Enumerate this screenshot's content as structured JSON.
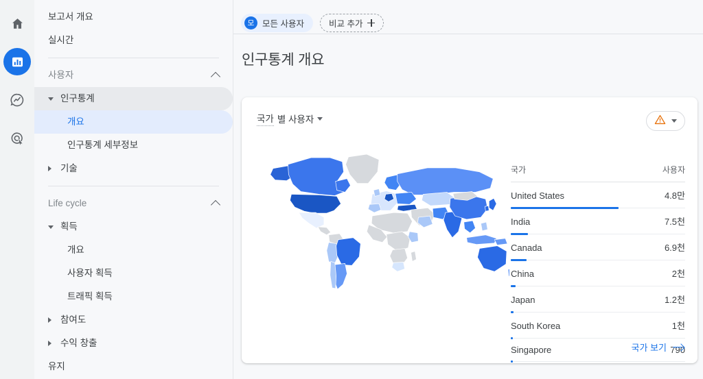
{
  "rail": {
    "items": [
      {
        "name": "home-icon",
        "label": "홈",
        "active": false
      },
      {
        "name": "reports-icon",
        "label": "보고서",
        "active": true
      },
      {
        "name": "explore-icon",
        "label": "탐색",
        "active": false
      },
      {
        "name": "advertising-icon",
        "label": "광고",
        "active": false
      }
    ]
  },
  "sidebar": {
    "items": [
      {
        "label": "보고서 개요",
        "level": 0,
        "state": "normal",
        "tri": "none"
      },
      {
        "label": "실시간",
        "level": 0,
        "state": "normal",
        "tri": "none"
      },
      {
        "divider": true
      },
      {
        "label": "사용자",
        "level": 0,
        "state": "section",
        "tri": "collapse-up"
      },
      {
        "label": "인구통계",
        "level": 1,
        "state": "hovered",
        "tri": "down"
      },
      {
        "label": "개요",
        "level": 2,
        "state": "selected",
        "tri": "none"
      },
      {
        "label": "인구통계 세부정보",
        "level": 2,
        "state": "normal",
        "tri": "none"
      },
      {
        "label": "기술",
        "level": 1,
        "state": "normal",
        "tri": "right"
      },
      {
        "divider": true
      },
      {
        "label": "Life cycle",
        "level": 0,
        "state": "section",
        "tri": "collapse-up"
      },
      {
        "label": "획득",
        "level": 1,
        "state": "normal",
        "tri": "down"
      },
      {
        "label": "개요",
        "level": 2,
        "state": "normal",
        "tri": "none"
      },
      {
        "label": "사용자 획득",
        "level": 2,
        "state": "normal",
        "tri": "none"
      },
      {
        "label": "트래픽 획득",
        "level": 2,
        "state": "normal",
        "tri": "none"
      },
      {
        "label": "참여도",
        "level": 1,
        "state": "normal",
        "tri": "right"
      },
      {
        "label": "수익 창출",
        "level": 1,
        "state": "normal",
        "tri": "right"
      },
      {
        "label": "유지",
        "level": 1,
        "state": "normal",
        "tri": "none"
      }
    ]
  },
  "topbar": {
    "segment_chip": {
      "initial": "모",
      "label": "모든 사용자"
    },
    "add_comparison": {
      "label": "비교 추가",
      "icon": "plus-icon"
    }
  },
  "page": {
    "title": "인구통계 개요"
  },
  "card": {
    "metric_selector": {
      "dimension": "국가",
      "rest": "별 사용자",
      "full": "국가 별 사용자"
    },
    "warning_button": {
      "icon": "warning-triangle-icon",
      "color": "#e8710a"
    },
    "footer_link": {
      "label": "국가 보기",
      "icon": "arrow-right-icon"
    }
  },
  "chart_data": {
    "type": "table",
    "title": "국가 별 사용자",
    "columns": [
      "국가",
      "사용자"
    ],
    "categories": [
      "United States",
      "India",
      "Canada",
      "China",
      "Japan",
      "South Korea",
      "Singapore"
    ],
    "values": [
      48000,
      7500,
      6900,
      2000,
      1200,
      1000,
      790
    ],
    "value_labels": [
      "4.8만",
      "7.5천",
      "6.9천",
      "2천",
      "1.2천",
      "1천",
      "790"
    ],
    "bar_pct": [
      100,
      15.6,
      14.4,
      4.2,
      2.5,
      2.1,
      1.6
    ],
    "bar_color": "#1a73e8",
    "map": {
      "type": "choropleth",
      "no_data_color": "#d6d9dd",
      "scale": [
        "#e8f0fe",
        "#aac8f8",
        "#7aa8f5",
        "#4285f4",
        "#1a56c4"
      ],
      "highlights": [
        {
          "country": "United States",
          "shade": 4
        },
        {
          "country": "Canada",
          "shade": 3
        },
        {
          "country": "India",
          "shade": 3
        },
        {
          "country": "China",
          "shade": 3
        },
        {
          "country": "Japan",
          "shade": 3
        },
        {
          "country": "South Korea",
          "shade": 3
        },
        {
          "country": "Singapore",
          "shade": 2
        },
        {
          "country": "Russia",
          "shade": 3
        },
        {
          "country": "Brazil",
          "shade": 3
        },
        {
          "country": "Australia",
          "shade": 3
        }
      ]
    }
  }
}
